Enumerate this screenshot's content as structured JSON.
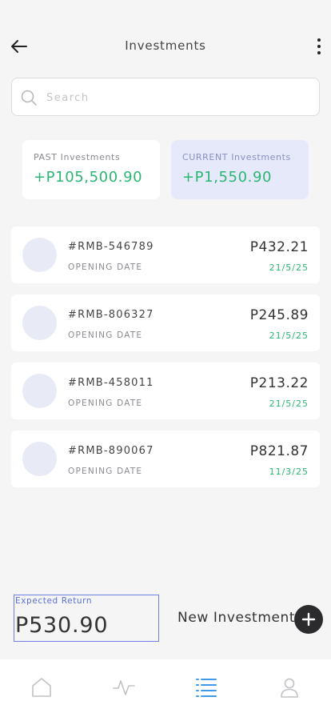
{
  "header": {
    "title": "Investments",
    "back_icon": "arrow-left-icon",
    "more_icon": "more-vertical-icon"
  },
  "search": {
    "placeholder": "Search",
    "value": ""
  },
  "summary": {
    "past": {
      "label": "PAST Investments",
      "value": "+P105,500.90"
    },
    "current": {
      "label": "CURRENT Investments",
      "value": "+P1,550.90"
    }
  },
  "investments": [
    {
      "id": "#RMB-546789",
      "sub_label": "OPENING DATE",
      "amount": "P432.21",
      "date": "21/5/25"
    },
    {
      "id": "#RMB-806327",
      "sub_label": "OPENING DATE",
      "amount": "P245.89",
      "date": "21/5/25"
    },
    {
      "id": "#RMB-458011",
      "sub_label": "OPENING DATE",
      "amount": "P213.22",
      "date": "21/5/25"
    },
    {
      "id": "#RMB-890067",
      "sub_label": "OPENING DATE",
      "amount": "P821.87",
      "date": "11/3/25"
    }
  ],
  "expected_return": {
    "label": "Expected Return",
    "value": "P530.90"
  },
  "new_investment": {
    "label": "New Investment",
    "icon": "plus-icon"
  },
  "tabbar": {
    "tabs": [
      {
        "icon": "home-icon",
        "active": false
      },
      {
        "icon": "activity-icon",
        "active": false
      },
      {
        "icon": "list-icon",
        "active": true
      },
      {
        "icon": "user-icon",
        "active": false
      }
    ]
  },
  "colors": {
    "positive": "#2bb673",
    "accent": "#3d9be9",
    "current_card_bg": "#e6e9fa",
    "selection_border": "#6f7fe3"
  }
}
